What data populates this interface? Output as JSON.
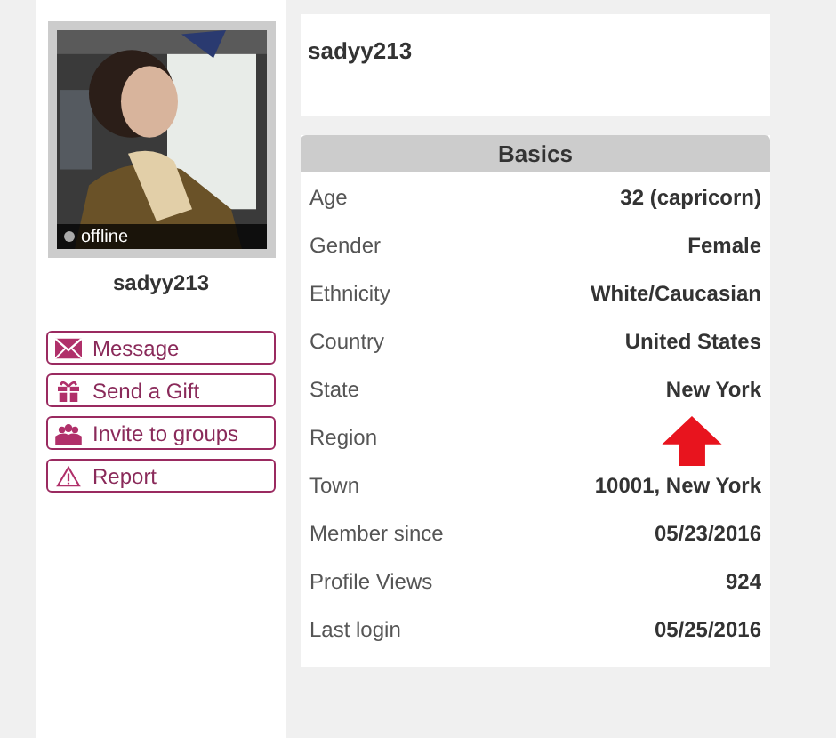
{
  "profile": {
    "photo": {
      "status": "offline"
    },
    "username": "sadyy213",
    "actions": [
      {
        "kind": "message",
        "label": "Message"
      },
      {
        "kind": "gift",
        "label": "Send a Gift"
      },
      {
        "kind": "groups",
        "label": "Invite to groups"
      },
      {
        "kind": "report",
        "label": "Report"
      }
    ]
  },
  "header": {
    "username": "sadyy213"
  },
  "basics": {
    "title": "Basics",
    "rows": [
      {
        "label": "Age",
        "value": "32 (capricorn)"
      },
      {
        "label": "Gender",
        "value": "Female"
      },
      {
        "label": "Ethnicity",
        "value": "White/Caucasian"
      },
      {
        "label": "Country",
        "value": "United States"
      },
      {
        "label": "State",
        "value": "New York"
      },
      {
        "label": "Region"
      },
      {
        "label": "Town",
        "value": "10001, New York"
      },
      {
        "label": "Member since",
        "value": "05/23/2016"
      },
      {
        "label": "Profile Views",
        "value": "924"
      },
      {
        "label": "Last login",
        "value": "05/25/2016"
      }
    ]
  }
}
